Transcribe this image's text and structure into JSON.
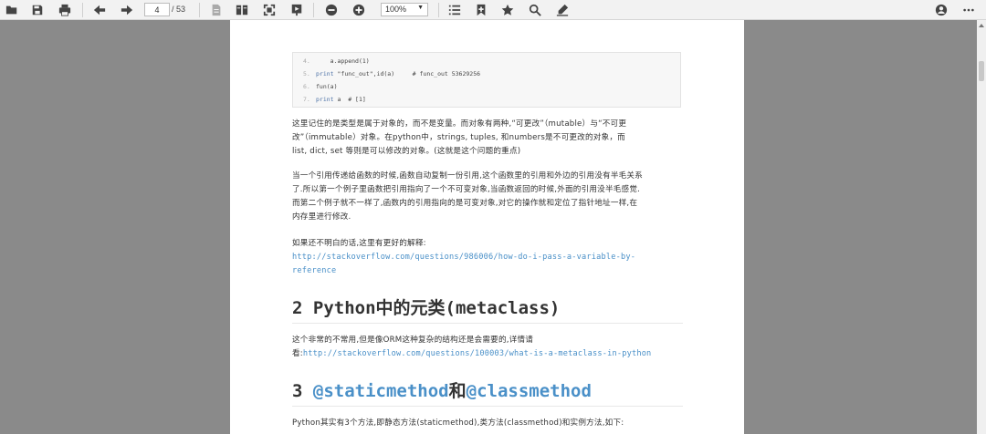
{
  "toolbar": {
    "page_current": "4",
    "page_total": "/ 53",
    "zoom": "100%",
    "icons": [
      "folder-open-icon",
      "save-icon",
      "print-icon",
      "arrow-left-icon",
      "arrow-right-icon",
      "single-page-icon",
      "two-page-icon",
      "fit-page-icon",
      "presentation-icon",
      "zoom-out-icon",
      "zoom-in-icon",
      "list-icon",
      "bookmark-add-icon",
      "star-icon",
      "search-icon",
      "pen-icon",
      "user-icon",
      "more-icon"
    ]
  },
  "code_block": [
    {
      "num": "4.",
      "text": "    a.append(1)"
    },
    {
      "num": "5.",
      "kw": "print",
      "text": " \"func_out\",id(a)     # func_out 53629256"
    },
    {
      "num": "6.",
      "text": "fun(a)"
    },
    {
      "num": "7.",
      "kw": "print",
      "text": " a  # [1]"
    }
  ],
  "paragraphs": {
    "p1_l1": "这里记住的是类型是属于对象的，而不是变量。而对象有两种,“可更改”（mutable）与“不可更",
    "p1_l2": "改”（immutable）对象。在python中，strings, tuples, 和numbers是不可更改的对象，而",
    "p1_l3": "list, dict, set 等则是可以修改的对象。(这就是这个问题的重点)",
    "p2_l1": "当一个引用传递给函数的时候,函数自动复制一份引用,这个函数里的引用和外边的引用没有半毛关系",
    "p2_l2": "了.所以第一个例子里函数把引用指向了一个不可变对象,当函数返回的时候,外面的引用没半毛感觉.",
    "p2_l3": "而第二个例子就不一样了,函数内的引用指向的是可变对象,对它的操作就和定位了指针地址一样,在",
    "p2_l4": "内存里进行修改.",
    "p3_l1": "如果还不明白的话,这里有更好的解释:",
    "p3_link_l1": "http://stackoverflow.com/questions/986006/how-do-i-pass-a-variable-by-",
    "p3_link_l2": "reference",
    "h2_metaclass": "2 Python中的元类(metaclass)",
    "p4_l1": "这个非常的不常用,但是像ORM这种复杂的结构还是会需要的,详情请",
    "p4_l2_prefix": "看:",
    "p4_link": "http://stackoverflow.com/questions/100003/what-is-a-metaclass-in-python",
    "h3_num": "3 ",
    "h3_code1": "@staticmethod",
    "h3_mid": "和",
    "h3_code2": "@classmethod",
    "p5_l1": "Python其实有3个方法,即静态方法(staticmethod),类方法(classmethod)和实例方法,如下:"
  }
}
